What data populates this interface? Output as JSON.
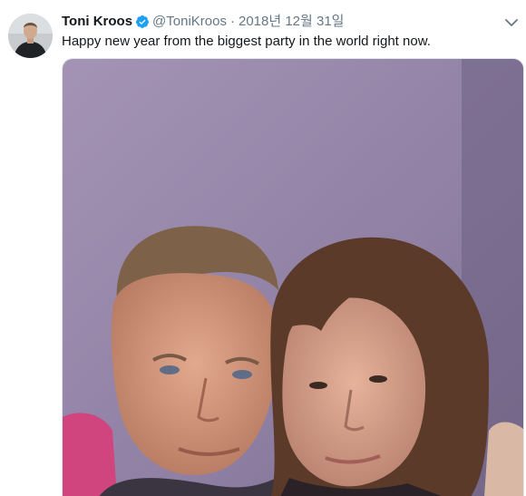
{
  "tweet": {
    "display_name": "Toni Kroos",
    "handle": "@ToniKroos",
    "separator": "·",
    "date": "2018년 12월 31일",
    "text": "Happy new year from the biggest party in the world right now.",
    "verified": true
  },
  "icons": {
    "verified": "verified-badge-icon",
    "menu": "chevron-down-icon"
  },
  "colors": {
    "verified_blue": "#1da1f2",
    "secondary_text": "#657786"
  }
}
